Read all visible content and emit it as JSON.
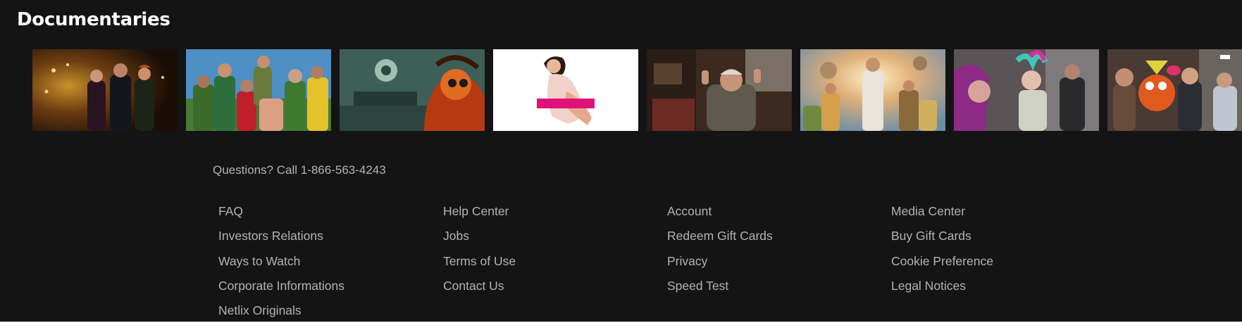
{
  "row": {
    "title": "Documentaries",
    "thumbnails": [
      {
        "icon": "movie-thumbnail"
      },
      {
        "icon": "movie-thumbnail"
      },
      {
        "icon": "movie-thumbnail"
      },
      {
        "icon": "movie-thumbnail"
      },
      {
        "icon": "movie-thumbnail"
      },
      {
        "icon": "movie-thumbnail"
      },
      {
        "icon": "movie-thumbnail"
      },
      {
        "icon": "movie-thumbnail"
      }
    ]
  },
  "footer": {
    "question": "Questions? Call 1-866-563-4243",
    "columns": [
      [
        "FAQ",
        "Investors Relations",
        "Ways to Watch",
        "Corporate Informations",
        "Netlix Originals"
      ],
      [
        "Help Center",
        "Jobs",
        "Terms of Use",
        "Contact Us"
      ],
      [
        "Account",
        "Redeem Gift Cards",
        "Privacy",
        "Speed Test"
      ],
      [
        "Media Center",
        "Buy Gift Cards",
        "Cookie Preference",
        "Legal Notices"
      ]
    ]
  },
  "colors": {
    "background": "#141414",
    "title": "#ffffff",
    "footer_text": "#b3b3b3",
    "censor_bar": "#e0127a"
  }
}
